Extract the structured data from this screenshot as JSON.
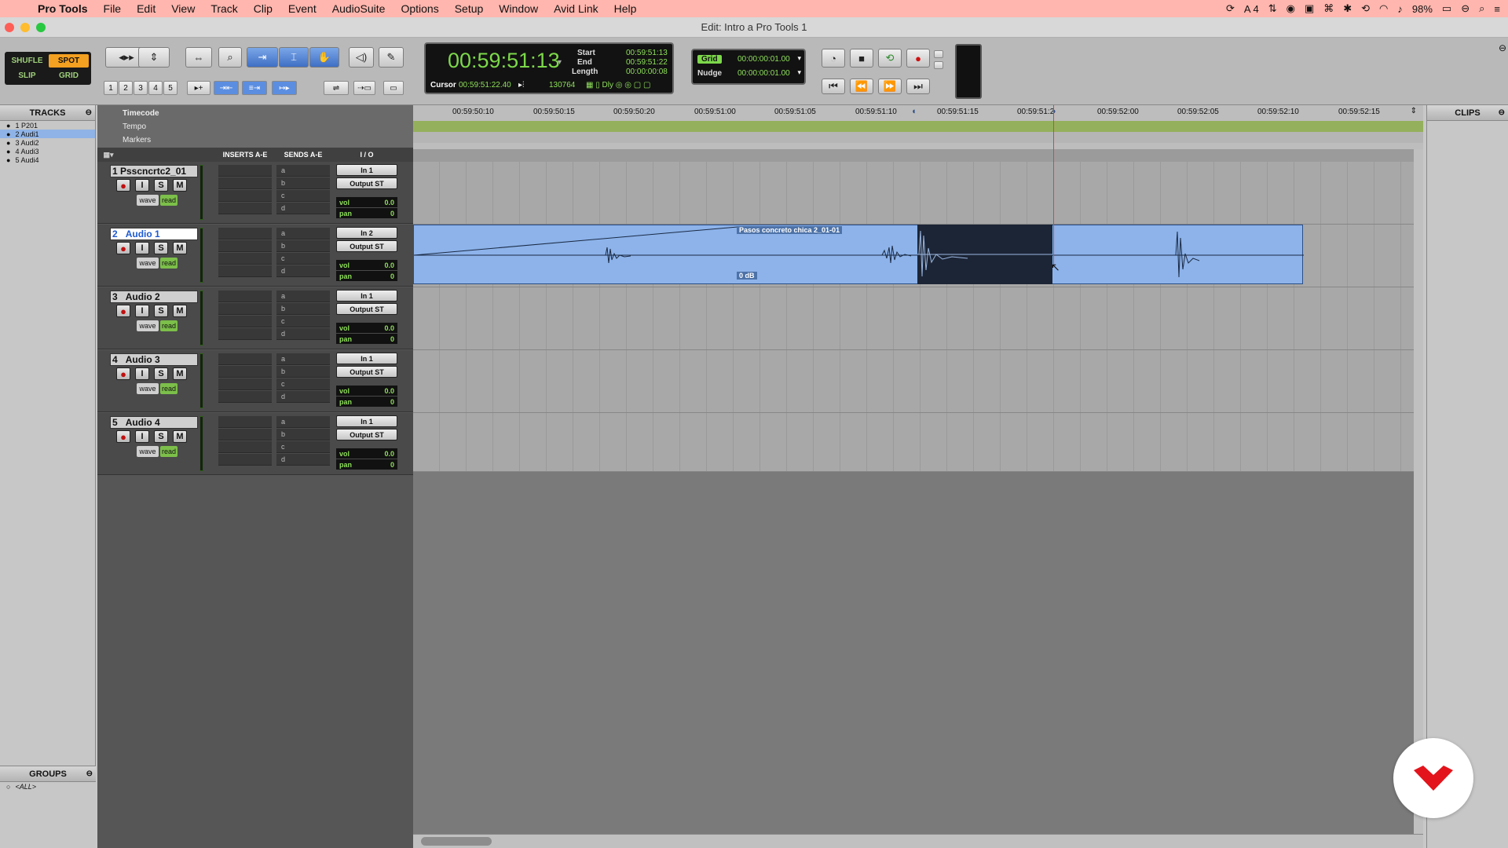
{
  "menubar": {
    "app": "Pro Tools",
    "items": [
      "File",
      "Edit",
      "View",
      "Track",
      "Clip",
      "Event",
      "AudioSuite",
      "Options",
      "Setup",
      "Window",
      "Avid Link",
      "Help"
    ],
    "status_a4": "4",
    "battery": "98%"
  },
  "window": {
    "title": "Edit: Intro a Pro Tools 1"
  },
  "modes": {
    "shuffle": "SHUFLE",
    "spot": "SPOT",
    "slip": "SLIP",
    "grid": "GRID"
  },
  "zoom_presets": [
    "1",
    "2",
    "3",
    "4",
    "5"
  ],
  "counter": {
    "main": "00:59:51:13",
    "start_label": "Start",
    "end_label": "End",
    "length_label": "Length",
    "start": "00:59:51:13",
    "end": "00:59:51:22",
    "length": "00:00:00:08",
    "cursor_label": "Cursor",
    "cursor": "00:59:51:22.40",
    "samples": "130764",
    "dly": "Dly"
  },
  "grid": {
    "grid_label": "Grid",
    "grid_value": "00:00:00:01.00",
    "nudge_label": "Nudge",
    "nudge_value": "00:00:00:01.00"
  },
  "panels": {
    "tracks": "TRACKS",
    "groups": "GROUPS",
    "groups_all": "<ALL>",
    "clips": "CLIPS"
  },
  "track_list": [
    "1 P201",
    "2 Audi1",
    "3 Audi2",
    "4 Audi3",
    "5 Audi4"
  ],
  "rulers": {
    "timecode": "Timecode",
    "tempo": "Tempo",
    "markers": "Markers"
  },
  "column_heads": {
    "inserts": "INSERTS A-E",
    "sends": "SENDS A-E",
    "io": "I / O"
  },
  "timecode_labels": [
    "00:59:50:10",
    "00:59:50:15",
    "00:59:50:20",
    "00:59:51:00",
    "00:59:51:05",
    "00:59:51:10",
    "00:59:51:15",
    "00:59:51:2",
    "00:59:52:00",
    "00:59:52:05",
    "00:59:52:10",
    "00:59:52:15"
  ],
  "tracks": [
    {
      "name": "1 Psscncrtc2_01",
      "input": "In 1",
      "output": "Output ST",
      "vol": "0.0",
      "pan": "0"
    },
    {
      "name": "Audio 1",
      "num": "2",
      "input": "In 2",
      "output": "Output ST",
      "vol": "0.0",
      "pan": "0"
    },
    {
      "name": "Audio 2",
      "num": "3",
      "input": "In 1",
      "output": "Output ST",
      "vol": "0.0",
      "pan": "0"
    },
    {
      "name": "Audio 3",
      "num": "4",
      "input": "In 1",
      "output": "Output ST",
      "vol": "0.0",
      "pan": "0"
    },
    {
      "name": "Audio 4",
      "num": "5",
      "input": "In 1",
      "output": "Output ST",
      "vol": "0.0",
      "pan": "0"
    }
  ],
  "track_strip": {
    "view": "wave",
    "auto": "read",
    "vol_label": "vol",
    "pan_label": "pan",
    "inserts": [
      "a",
      "b",
      "c",
      "d"
    ],
    "sends": [
      "a",
      "b",
      "c",
      "d"
    ]
  },
  "clip": {
    "name": "Pasos concreto chica 2_01-01",
    "gain": "0 dB"
  },
  "colors": {
    "clip": "#8db3ea",
    "selection": "#1c2536",
    "counter_green": "#7cd84a",
    "menubar": "#ffb6ae"
  }
}
